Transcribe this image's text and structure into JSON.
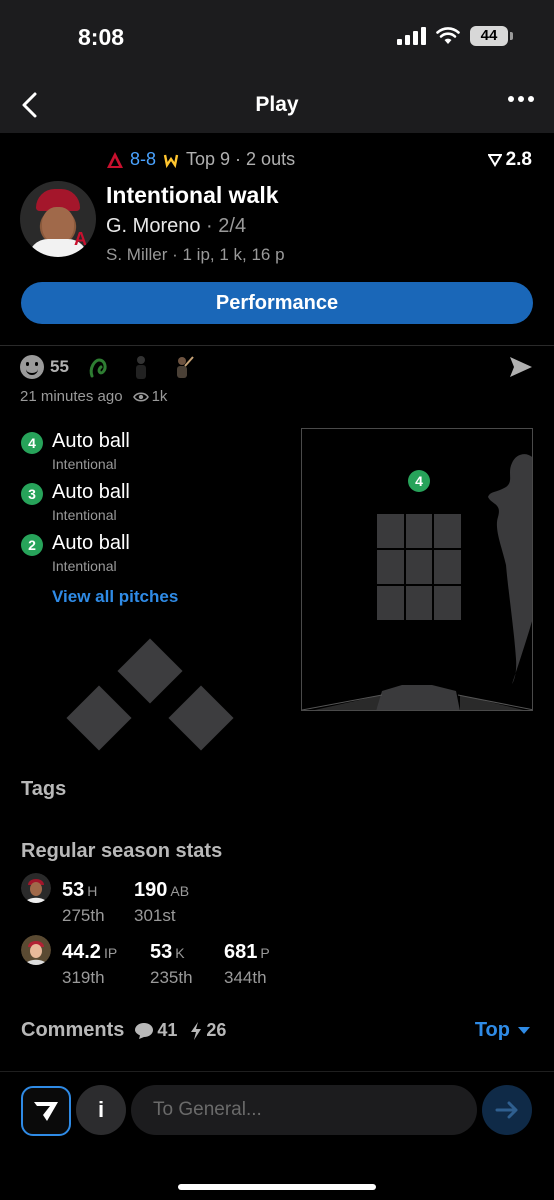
{
  "status_bar": {
    "time": "8:08",
    "battery": "44"
  },
  "nav": {
    "title": "Play"
  },
  "game": {
    "score": "8-8",
    "inning": "Top 9 · 2 outs",
    "odds": "2.8"
  },
  "play": {
    "title": "Intentional walk",
    "batter_name": "G. Moreno",
    "batter_line": " · 2/4",
    "pitcher_line": "S. Miller · 1 ip, 1 k, 16 p",
    "performance_label": "Performance"
  },
  "engagement": {
    "reaction_count": "55",
    "time_ago": "21 minutes ago",
    "views": "1k"
  },
  "pitches": [
    {
      "num": "4",
      "label": "Auto ball",
      "type": "Intentional"
    },
    {
      "num": "3",
      "label": "Auto ball",
      "type": "Intentional"
    },
    {
      "num": "2",
      "label": "Auto ball",
      "type": "Intentional"
    }
  ],
  "view_all_label": "View all pitches",
  "zone": {
    "pitch_marker": "4"
  },
  "sections": {
    "tags": "Tags",
    "season_stats": "Regular season stats"
  },
  "batter_stats": [
    {
      "value": "53",
      "unit": "H",
      "rank": "275th"
    },
    {
      "value": "190",
      "unit": "AB",
      "rank": "301st"
    }
  ],
  "pitcher_stats": [
    {
      "value": "44.2",
      "unit": "IP",
      "rank": "319th"
    },
    {
      "value": "53",
      "unit": "K",
      "rank": "235th"
    },
    {
      "value": "681",
      "unit": "P",
      "rank": "344th"
    }
  ],
  "comments": {
    "label": "Comments",
    "count": "41",
    "bolt_count": "26",
    "sort": "Top"
  },
  "composer": {
    "info": "i",
    "placeholder": "To General..."
  },
  "colors": {
    "accent": "#1a67b8",
    "link": "#2f8be6",
    "pitch_green": "#27a35a"
  }
}
